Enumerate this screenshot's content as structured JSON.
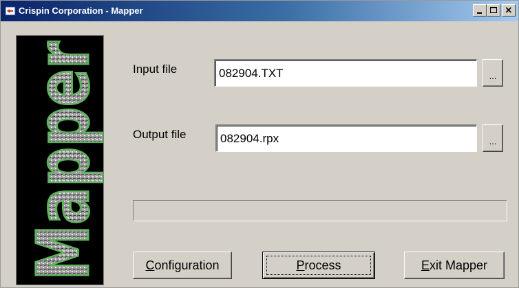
{
  "window": {
    "title": "Crispin Corporation - Mapper",
    "controls": {
      "minimize_icon": "minimize-icon",
      "maximize_icon": "maximize-icon",
      "close_icon": "close-icon"
    }
  },
  "logo": {
    "text": "Mapper",
    "text_color": "#5bb35a",
    "background": "#000000"
  },
  "form": {
    "input_file": {
      "label": "Input file",
      "value": "082904.TXT",
      "browse_label": "..."
    },
    "output_file": {
      "label": "Output file",
      "value": "082904.rpx",
      "browse_label": "..."
    }
  },
  "progress": {
    "value_percent": 0
  },
  "buttons": {
    "configuration": {
      "mnemonic": "C",
      "rest": "onfiguration"
    },
    "process": {
      "mnemonic": "P",
      "rest": "rocess"
    },
    "exit": {
      "mnemonic": "E",
      "rest": "xit Mapper"
    }
  },
  "colors": {
    "titlebar_start": "#0a246a",
    "titlebar_end": "#a6caf0",
    "face": "#d4d0c8"
  }
}
